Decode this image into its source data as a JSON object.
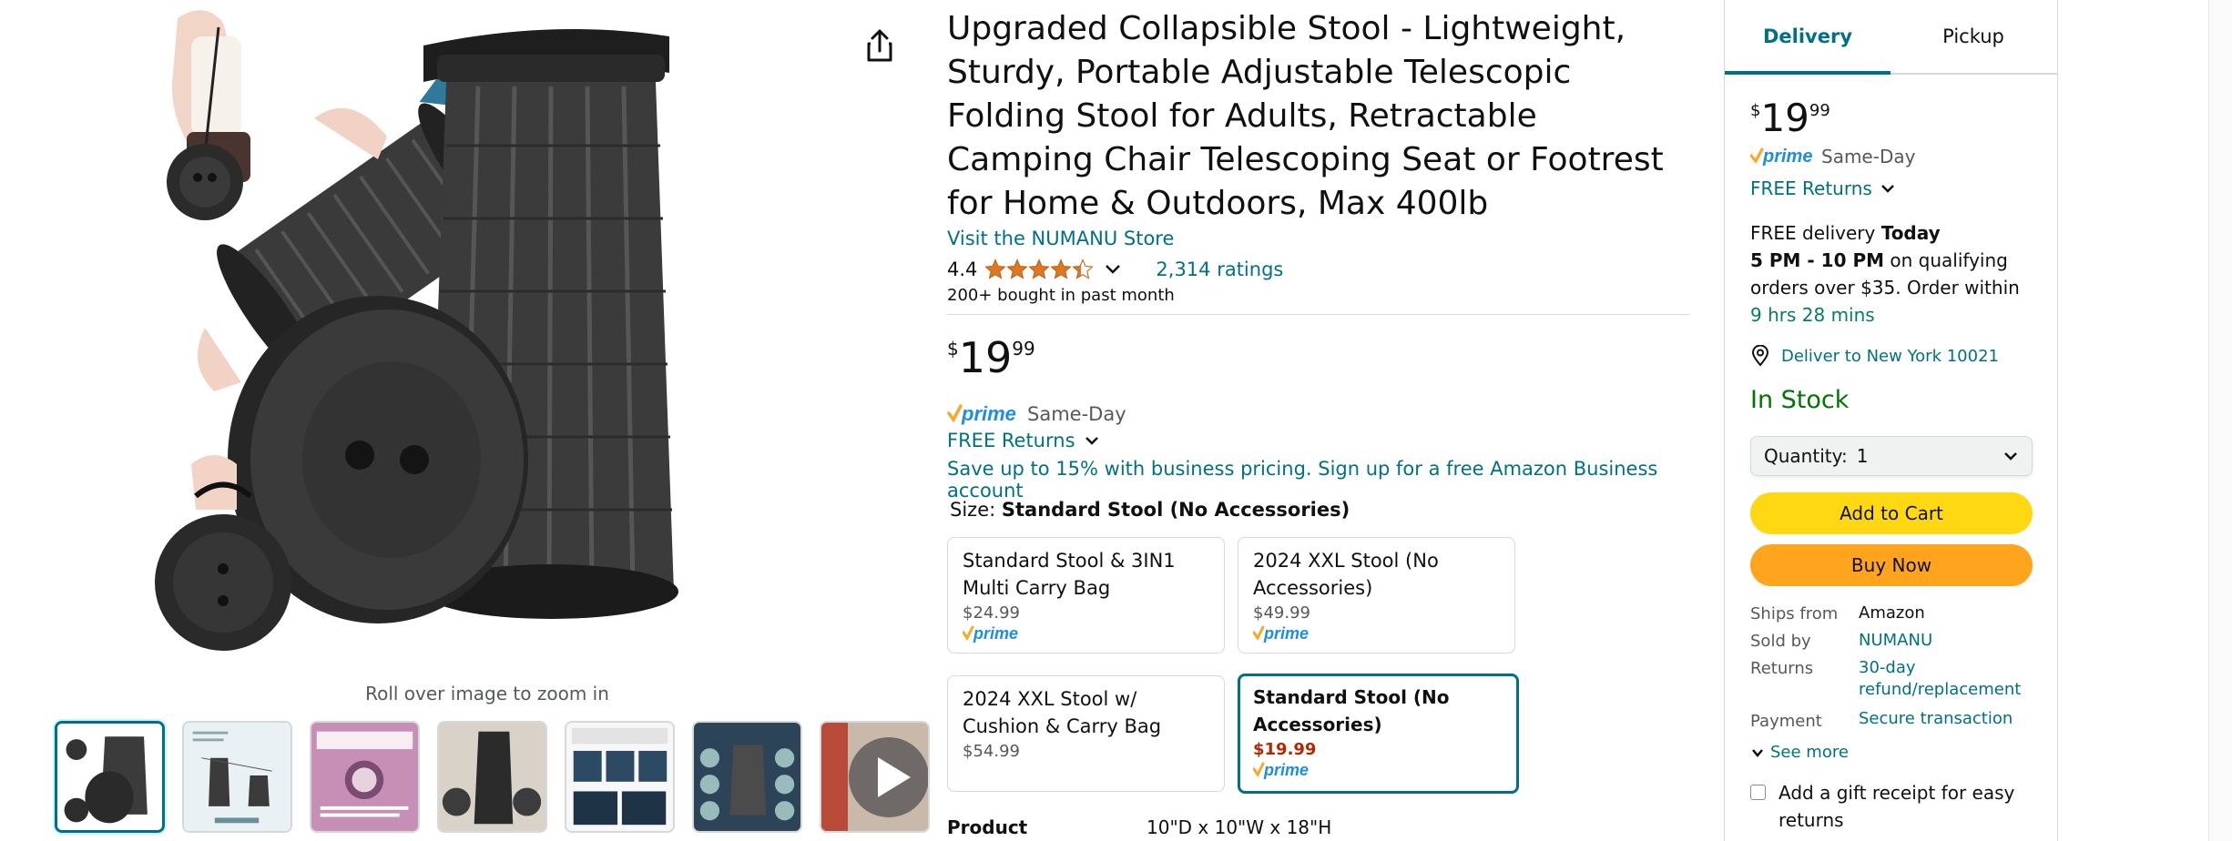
{
  "gallery": {
    "zoom_hint": "Roll over image to zoom in",
    "thumbnails": [
      {
        "kind": "stool-photo",
        "selected": true
      },
      {
        "kind": "dimension-infographic",
        "selected": false,
        "brand": "NUMANU"
      },
      {
        "kind": "warranty-infographic",
        "selected": false,
        "brand": "NUMANU",
        "headline": "PEACE OF MIND WHEN PURCHASING NUMANU"
      },
      {
        "kind": "lifestyle-photo",
        "selected": false
      },
      {
        "kind": "usage-infographic",
        "selected": false,
        "headline": "READY FOR USE IN SECONDS",
        "brand": "NUMANU"
      },
      {
        "kind": "feature-infographic",
        "selected": false,
        "brand": "NUMANU"
      },
      {
        "kind": "video",
        "selected": false
      }
    ]
  },
  "product": {
    "title": "Upgraded Collapsible Stool - Lightweight, Sturdy, Portable Adjustable Telescopic Folding Stool for Adults, Retractable Camping Chair Telescoping Seat or Footrest for Home & Outdoors, Max 400lb",
    "store_link": "Visit the NUMANU Store",
    "rating": "4.4",
    "stars_value": 4.4,
    "ratings_count": "2,314 ratings",
    "bought": "200+ bought in past month",
    "price": {
      "symbol": "$",
      "whole": "19",
      "fraction": "99"
    },
    "prime_delivery": "Same-Day",
    "free_returns": "FREE Returns",
    "business_offer": "Save up to 15% with business pricing. Sign up for a free Amazon Business account",
    "size_label": "Size:",
    "size_selected": "Standard Stool (No Accessories)",
    "options": [
      {
        "name": "Standard Stool & 3IN1 Multi Carry Bag",
        "price": "$24.99",
        "prime": true
      },
      {
        "name": "2024 XXL Stool (No Accessories)",
        "price": "$49.99",
        "prime": true
      },
      {
        "name": "2024 XXL Stool w/ Cushion & Carry Bag",
        "price": "$54.99",
        "prime": false
      },
      {
        "name": "Standard Stool (No Accessories)",
        "price": "$19.99",
        "prime": true,
        "selected": true
      }
    ],
    "dimensions_label": "Product Dimensions",
    "dimensions_value": "10\"D x 10\"W x 18\"H"
  },
  "buybox": {
    "tabs": [
      "Delivery",
      "Pickup"
    ],
    "active_tab": "Delivery",
    "price": {
      "symbol": "$",
      "whole": "19",
      "fraction": "99"
    },
    "prime_delivery": "Same-Day",
    "free_returns": "FREE Returns",
    "delivery": {
      "prefix": "FREE delivery ",
      "day": "Today",
      "window": "5 PM - 10 PM",
      "middle": " on qualifying orders over $35. Order within ",
      "countdown": "9 hrs 28 mins"
    },
    "deliver_to": "Deliver to New York 10021",
    "stock": "In Stock",
    "quantity_label": "Quantity:",
    "quantity_value": "1",
    "add_to_cart": "Add to Cart",
    "buy_now": "Buy Now",
    "info": [
      {
        "key": "Ships from",
        "value": "Amazon",
        "link": false
      },
      {
        "key": "Sold by",
        "value": "NUMANU",
        "link": true
      },
      {
        "key": "Returns",
        "value": "30-day refund/replacement",
        "link": true
      },
      {
        "key": "Payment",
        "value": "Secure transaction",
        "link": true
      }
    ],
    "see_more": "See more",
    "gift_receipt": "Add a gift receipt for easy returns"
  },
  "colors": {
    "link": "#007185",
    "prime_blue": "#1f8ce6",
    "prime_check": "#f7a928",
    "star": "#de7921",
    "in_stock": "#007600",
    "countdown": "#067d62",
    "deal_price": "#b12704",
    "add_to_cart": "#ffd814",
    "buy_now": "#ffa41c"
  },
  "icons": {
    "share": "share-icon",
    "chevron": "chevron-down-icon",
    "location": "location-pin-icon",
    "play": "play-icon",
    "prime": "prime-logo-icon"
  }
}
